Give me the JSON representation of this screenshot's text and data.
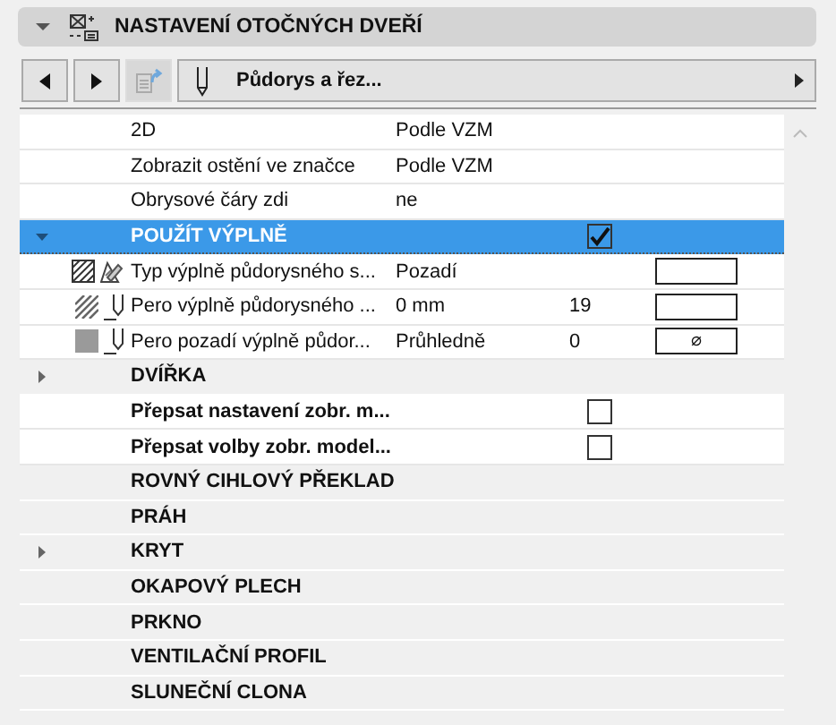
{
  "panel": {
    "title": "NASTAVENÍ OTOČNÝCH DVEŘÍ",
    "expanded": true
  },
  "toolbar": {
    "view": "Půdorys a řez..."
  },
  "rows": [
    {
      "kind": "param",
      "label": "2D",
      "value": "Podle VZM"
    },
    {
      "kind": "param",
      "label": "Zobrazit ostění ve značce",
      "value": "Podle VZM"
    },
    {
      "kind": "param",
      "label": "Obrysové čáry zdi",
      "value": "ne"
    },
    {
      "kind": "group",
      "label": "POUŽÍT VÝPLNĚ",
      "expanded": true,
      "selected": true,
      "checked": true
    },
    {
      "kind": "pattern",
      "label": "Typ výplně půdorysného s...",
      "value": "Pozadí"
    },
    {
      "kind": "pen",
      "label": "Pero výplně půdorysného ...",
      "value": "0 mm",
      "number": "19"
    },
    {
      "kind": "background",
      "label": "Pero pozadí výplně půdor...",
      "value": "Průhledně",
      "number": "0",
      "swatch": "⌀"
    },
    {
      "kind": "group",
      "label": "DVÍŘKA",
      "expanded": false,
      "selected": false
    },
    {
      "kind": "check",
      "label": "Přepsat nastavení zobr. m...",
      "checked": false
    },
    {
      "kind": "check",
      "label": "Přepsat volby zobr. model...",
      "checked": false
    },
    {
      "kind": "group",
      "label": "ROVNÝ CIHLOVÝ PŘEKLAD",
      "selected": false
    },
    {
      "kind": "group",
      "label": "PRÁH",
      "selected": false
    },
    {
      "kind": "group",
      "label": "KRYT",
      "expanded": false,
      "selected": false
    },
    {
      "kind": "group",
      "label": "OKAPOVÝ PLECH",
      "selected": false
    },
    {
      "kind": "group",
      "label": "PRKNO",
      "selected": false
    },
    {
      "kind": "group",
      "label": "VENTILAČNÍ PROFIL",
      "selected": false
    },
    {
      "kind": "group",
      "label": "SLUNEČNÍ CLONA",
      "selected": false
    }
  ]
}
